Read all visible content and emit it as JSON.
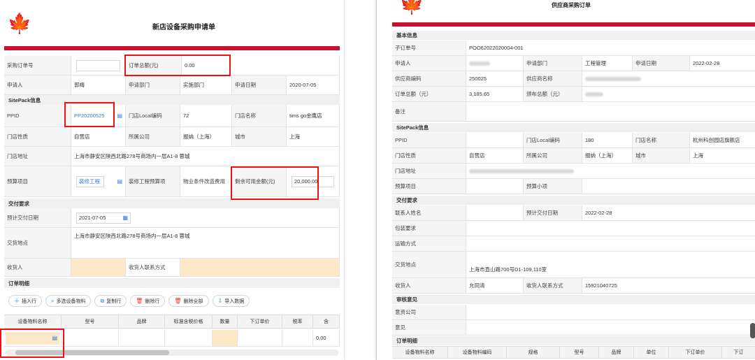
{
  "left_form": {
    "title": "新店设备采购申请单",
    "logo_text": "Tims",
    "labels": {
      "order_no": "采购订单号",
      "order_total": "订单总额(元)",
      "applicant": "申请人",
      "dept": "申请部门",
      "date": "申请日期",
      "sitepack": "SitePack信息",
      "ppid": "PPID",
      "local_code": "门店Local编码",
      "store_name": "门店名称",
      "store_type": "门店性质",
      "company": "所属公司",
      "region": "报纳（上海）",
      "city": "城市",
      "address": "门店地址",
      "budget": "预算项目",
      "repair_budget": "装修工程预算项",
      "property": "物业条件改造费用",
      "remaining": "剩余可用金额(元)",
      "delivery": "交付要求",
      "delivery_date": "预计交付日期",
      "delivery_place": "交货地点",
      "receiver": "收货人",
      "receiver_contact": "收货人联系方式",
      "details": "订单明细"
    },
    "values": {
      "order_no": "",
      "order_total": "0.00",
      "applicant": "郭梅",
      "dept": "实施部门",
      "date": "2020-07-05",
      "ppid": "PP20200525",
      "local_code": "72",
      "store_name": "tims go金鹰店",
      "store_type": "自营店",
      "city": "上海",
      "address": "上海市静安区陕西北路278号商场内一层A1-8 蓉城",
      "budget": "装修工程",
      "remaining": "20,000.00",
      "delivery_date": "2021-07-05",
      "delivery_place": "上海市静安区陕西北路278号商场内一层A1-8 蓉城",
      "line_total": "0.00"
    },
    "buttons": [
      "插入行",
      "多选设备物料",
      "复制行",
      "删除行",
      "删除全部",
      "导入数据"
    ],
    "grid_headers": [
      "设备物料名称",
      "型号",
      "品牌",
      "标准含税价格",
      "数量",
      "下订单价",
      "税率",
      "含"
    ]
  },
  "right_form": {
    "title": "供应商采购订单",
    "logo_text": "Tims",
    "labels": {
      "basic": "基本信息",
      "sub_order": "子订单号",
      "applicant": "申请人",
      "dept": "申请部门",
      "date": "申请日期",
      "supplier_code": "供应商编码",
      "supplier_name": "供应商名称",
      "order_total": "订单总额（元）",
      "tax_total": "颁布总额（元）",
      "remark": "备注",
      "sitepack": "SitePack信息",
      "ppid": "PPID",
      "local_code": "门店Local编码",
      "store_name": "门店名称",
      "store_type": "门店性质",
      "company": "所属公司",
      "region": "报纳（上海）",
      "city": "城市",
      "address": "门店地址",
      "budget": "预算项目",
      "budget_sub": "预算小项",
      "delivery": "交付要求",
      "contact": "联系人姓名",
      "delivery_date": "预计交付日期",
      "packaging": "包装要求",
      "transport": "运输方式",
      "delivery_place": "交货地点",
      "receiver": "收货人",
      "receiver_contact": "收货人联系方式",
      "approval": "审核意见",
      "approve_company": "意资公司",
      "opinion": "意见",
      "details": "订单明细"
    },
    "values": {
      "sub_order": "POO62022020004-001",
      "dept": "工程管理",
      "date": "2022-02-28",
      "supplier_code": "250025",
      "order_total": "3,185.65",
      "local_code": "180",
      "store_name": "杭州科创园店旗舰店",
      "store_type": "自营店",
      "city": "上海",
      "delivery_date": "2022-02-28",
      "delivery_place": "上海市直山路700号D1-109,110室",
      "receiver": "允同清",
      "receiver_contact": "15921040725"
    },
    "grid_headers": [
      "设备物料名称",
      "设备物料编码",
      "规格",
      "型号",
      "品牌",
      "单位",
      "下订单价",
      "下订"
    ]
  },
  "colors": {
    "brand_red": "#c8102e",
    "highlight_red": "#ee1111",
    "link_blue": "#2b7de1",
    "peach": "#fde9c8"
  }
}
